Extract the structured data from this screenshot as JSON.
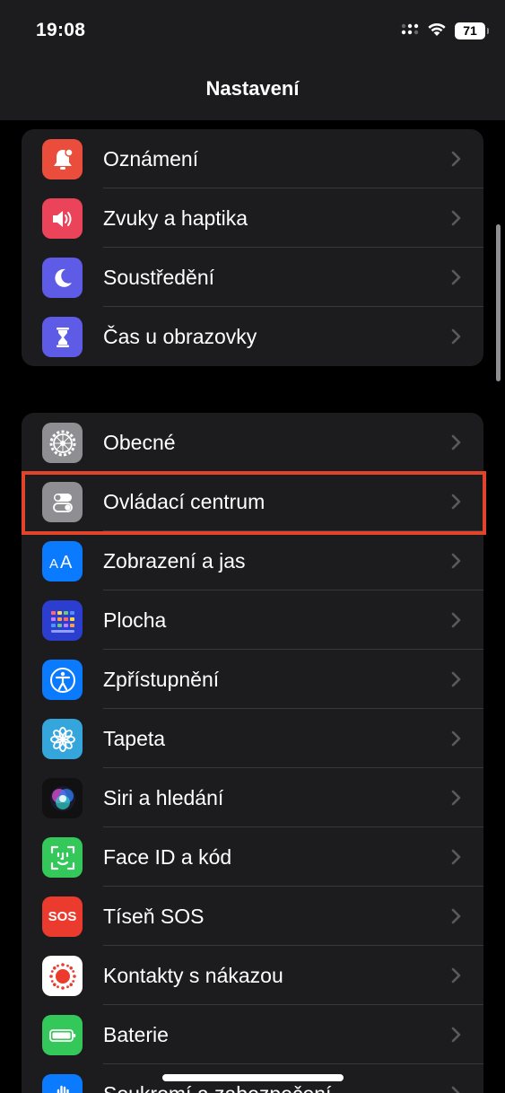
{
  "status_bar": {
    "time": "19:08",
    "battery_level": "71"
  },
  "nav": {
    "title": "Nastavení"
  },
  "group1": {
    "items": [
      {
        "label": "Oznámení",
        "icon": "bell-badge-icon",
        "color": "#eb4d3d"
      },
      {
        "label": "Zvuky a haptika",
        "icon": "speaker-icon",
        "color": "#eb445a"
      },
      {
        "label": "Soustředění",
        "icon": "moon-icon",
        "color": "#5e5ce6"
      },
      {
        "label": "Čas u obrazovky",
        "icon": "hourglass-icon",
        "color": "#5e5ce6"
      }
    ]
  },
  "group2": {
    "items": [
      {
        "label": "Obecné",
        "icon": "gear-icon",
        "color": "#8e8e93"
      },
      {
        "label": "Ovládací centrum",
        "icon": "toggles-icon",
        "color": "#8e8e93",
        "highlighted": true
      },
      {
        "label": "Zobrazení a jas",
        "icon": "text-size-icon",
        "color": "#0a7aff"
      },
      {
        "label": "Plocha",
        "icon": "home-screen-grid-icon",
        "color": "#2c3ed0"
      },
      {
        "label": "Zpřístupnění",
        "icon": "accessibility-icon",
        "color": "#0a7aff"
      },
      {
        "label": "Tapeta",
        "icon": "flower-icon",
        "color": "#35a6dc"
      },
      {
        "label": "Siri a hledání",
        "icon": "siri-icon",
        "color": "#111111"
      },
      {
        "label": "Face ID a kód",
        "icon": "face-id-icon",
        "color": "#34c759"
      },
      {
        "label": "Tíseň SOS",
        "icon": "sos-icon",
        "color": "#eb3b2f",
        "icon_text": "SOS"
      },
      {
        "label": "Kontakty s nákazou",
        "icon": "exposure-icon",
        "color": "#ffffff"
      },
      {
        "label": "Baterie",
        "icon": "battery-icon",
        "color": "#34c759"
      },
      {
        "label": "Soukromí a zabezpečení",
        "icon": "hand-icon",
        "color": "#0a7aff"
      }
    ]
  }
}
